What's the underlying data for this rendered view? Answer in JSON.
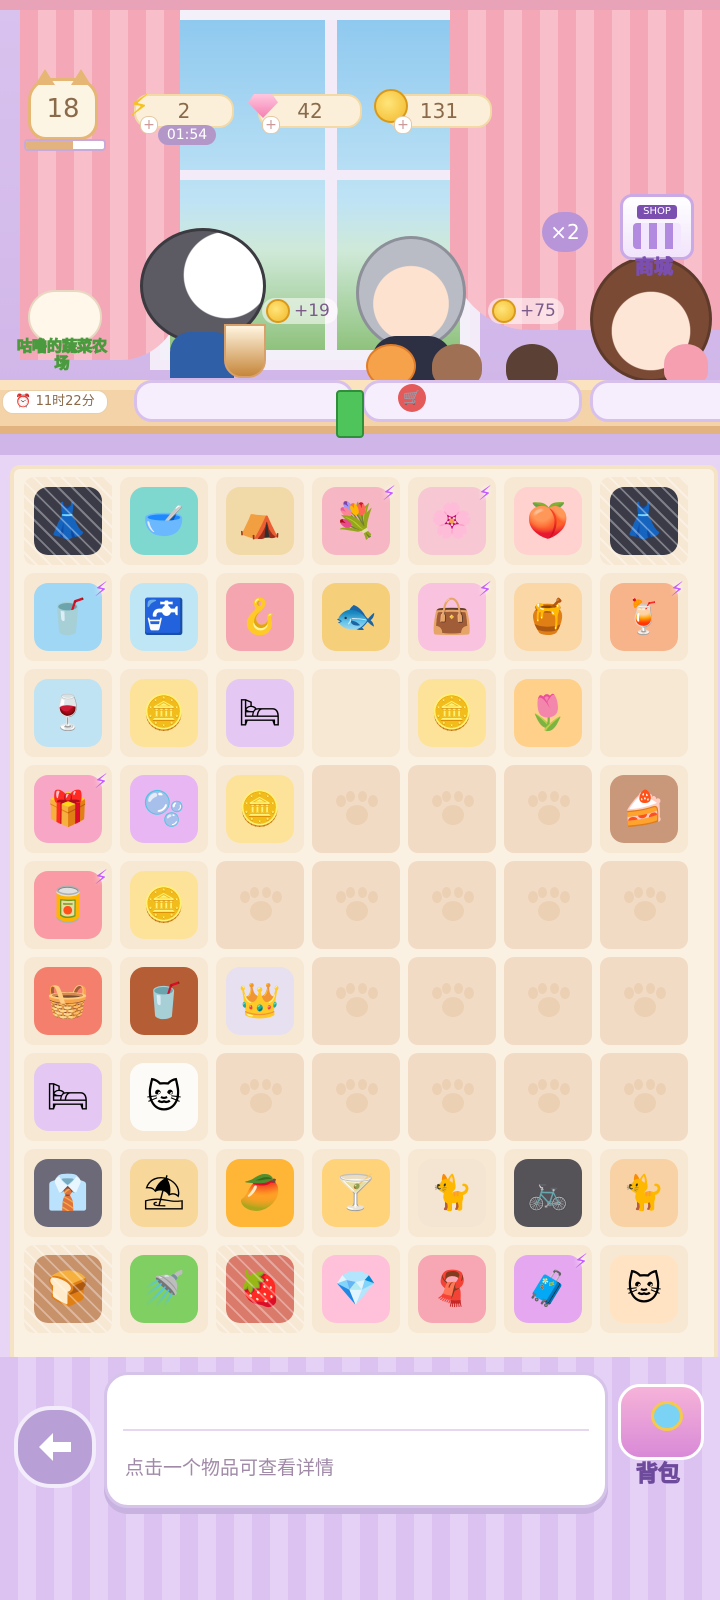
{
  "hud": {
    "level": "18",
    "xp_progress": 0.6,
    "energy": "2",
    "energy_timer": "01:54",
    "gems": "42",
    "coins": "131"
  },
  "shop": {
    "label": "商城",
    "sign": "SHOP"
  },
  "multiplier": "×2",
  "farm": {
    "title": "咕噜的蔬菜农场",
    "timer": "11时22分"
  },
  "customers": [
    {
      "name": "cat-maid",
      "reward": "+19"
    },
    {
      "name": "grey-hair-man",
      "reward": "+75"
    },
    {
      "name": "brown-hair-woman",
      "reward": ""
    }
  ],
  "board": {
    "rows": [
      [
        "dress-dark-webbed",
        "pet-bowl-teal",
        "teepee-tent",
        "flower-box-energy",
        "flower-crate-energy",
        "peach",
        "dress-red-webbed"
      ],
      [
        "cup-energy",
        "water-dispenser",
        "hanger-pink",
        "fish-plate",
        "bag-pink-energy",
        "honey-jar-stand",
        "glass-energy"
      ],
      [
        "wine-glass-ribbon",
        "coins-2",
        "pet-bed-purple",
        "paw-empty",
        "coin",
        "tulip-orange",
        "paw-empty"
      ],
      [
        "gift-box-energy",
        "cushion-purple",
        "coins-pile",
        "paw",
        "paw",
        "paw",
        "cake-bowl"
      ],
      [
        "vending-machine-energy",
        "coins-stack",
        "paw",
        "paw",
        "paw",
        "paw",
        "paw"
      ],
      [
        "fruit-basket",
        "cola-glass",
        "tiara",
        "paw",
        "paw",
        "paw",
        "paw"
      ],
      [
        "pet-bed-round",
        "cat-white",
        "paw",
        "paw",
        "paw",
        "paw",
        "paw"
      ],
      [
        "shirt-dress",
        "sand-shovel",
        "mango-juice",
        "cocktail",
        "cat-siamese",
        "bike-dark",
        "cat-calico"
      ],
      [
        "toaster-webbed",
        "watering-can",
        "berry-jar-webbed",
        "gem-pink",
        "towel-pink",
        "suitcase-energy",
        "lucky-cat"
      ]
    ]
  },
  "info": {
    "text": "点击一个物品可查看详情"
  },
  "bag": {
    "label": "背包"
  }
}
